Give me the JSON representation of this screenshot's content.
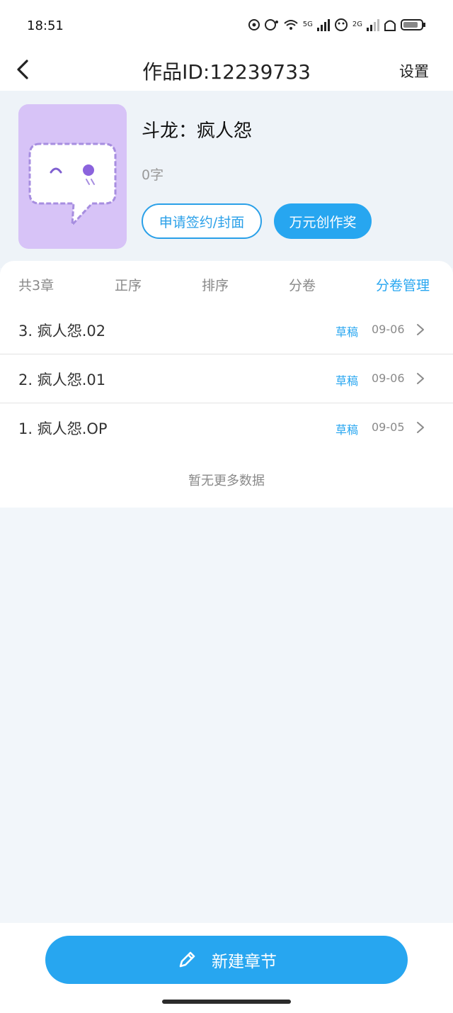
{
  "status_bar": {
    "time": "18:51",
    "network_5g": "5G",
    "network_2g": "2G"
  },
  "navbar": {
    "title": "作品ID:12239733",
    "settings_label": "设置",
    "back_icon": "chevron-left-icon"
  },
  "book": {
    "title": "斗龙：疯人怨",
    "word_count": "0字",
    "cover_color": "#d7c3f7",
    "sign_button_label": "申请签约/封面",
    "award_button_label": "万元创作奖"
  },
  "tabs": {
    "total": "共3章",
    "order": "正序",
    "sort": "排序",
    "volume": "分卷",
    "volume_manage": "分卷管理"
  },
  "chapters": [
    {
      "title": "3. 疯人怨.02",
      "status": "草稿",
      "date": "09-06"
    },
    {
      "title": "2. 疯人怨.01",
      "status": "草稿",
      "date": "09-06"
    },
    {
      "title": "1. 疯人怨.OP",
      "status": "草稿",
      "date": "09-05"
    }
  ],
  "list_footer": "暂无更多数据",
  "bottom": {
    "new_chapter_label": "新建章节",
    "new_chapter_icon": "pencil-icon"
  },
  "colors": {
    "accent": "#27a6f0",
    "background": "#f2f6fa"
  }
}
